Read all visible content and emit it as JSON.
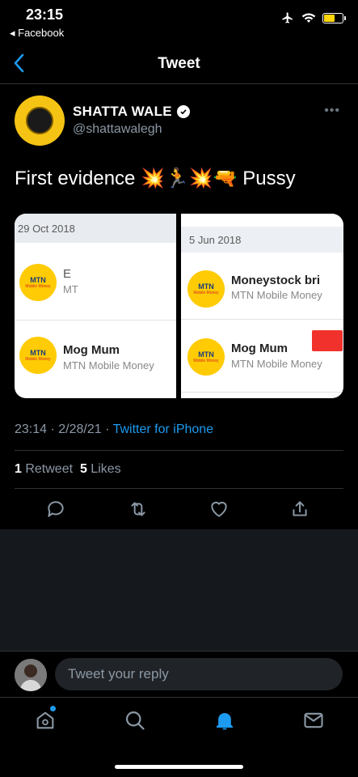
{
  "status_bar": {
    "time": "23:15",
    "back_app": "◂ Facebook"
  },
  "nav": {
    "title": "Tweet"
  },
  "tweet": {
    "author_name": "SHATTA WALE",
    "author_handle": "@shattawalegh",
    "text": "First evidence 💥🏃💥🔫 Pussy",
    "timestamp": "23:14 · 2/28/21 · ",
    "source": "Twitter for iPhone",
    "retweet_count": "1",
    "retweet_label": " Retweet",
    "like_count": "5",
    "like_label": " Likes"
  },
  "media": {
    "left": {
      "date": "29 Oct 2018",
      "rows": [
        {
          "name": "E",
          "sub": "MT"
        },
        {
          "name": "Mog Mum",
          "sub": "MTN Mobile Money"
        }
      ]
    },
    "right": {
      "date": "5 Jun 2018",
      "rows": [
        {
          "name": "Moneystock bri",
          "sub": "MTN Mobile Money"
        },
        {
          "name": "Mog Mum",
          "sub": "MTN Mobile Money"
        }
      ]
    },
    "logo_text": "MTN",
    "logo_sub": "Mobile Money"
  },
  "reply": {
    "placeholder": "Tweet your reply"
  },
  "icons": {
    "back": "chevron-left-icon",
    "verified": "verified-badge-icon",
    "more": "more-icon",
    "reply": "comment-icon",
    "retweet": "retweet-icon",
    "like": "heart-icon",
    "share": "share-icon",
    "home": "home-icon",
    "search": "search-icon",
    "notifications": "bell-icon",
    "messages": "mail-icon"
  },
  "colors": {
    "accent": "#1d9bf0",
    "battery": "#ffd60a",
    "avatar_bg": "#f5c313",
    "mtn_yellow": "#ffcb05"
  }
}
